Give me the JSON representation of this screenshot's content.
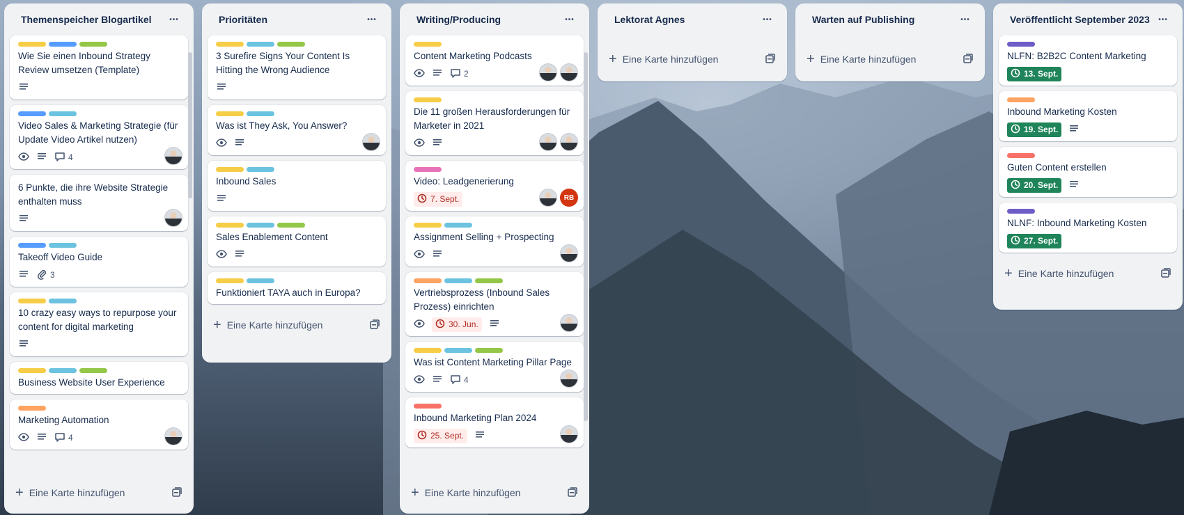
{
  "colors": {
    "yellow": "#f5cd47",
    "blue": "#579dff",
    "green": "#94c748",
    "sky": "#6cc3e0",
    "orange": "#fea362",
    "pink": "#e774bb",
    "red": "#f87168",
    "purple": "#6e5dc6",
    "done_green": "#1f845a",
    "overdue_bg": "#ffeceb"
  },
  "add_card_label": "Eine Karte hinzufügen",
  "lists": [
    {
      "title": "Themenspeicher Blogartikel",
      "cards": [
        {
          "labels": [
            "yellow",
            "blue",
            "green"
          ],
          "title": "Wie Sie einen Inbound Strategy Review umsetzen (Template)",
          "badges": {
            "desc": true
          }
        },
        {
          "labels": [
            "blue",
            "sky"
          ],
          "title": "Video Sales & Marketing Strategie (für Update Video Artikel nutzen)",
          "badges": {
            "watch": true,
            "desc": true,
            "comments": "4"
          },
          "members": [
            "avatar"
          ]
        },
        {
          "labels": [],
          "title": "6 Punkte, die ihre Website Strategie enthalten muss",
          "badges": {
            "desc": true
          },
          "members": [
            "avatar"
          ]
        },
        {
          "labels": [
            "blue",
            "sky"
          ],
          "title": "Takeoff Video Guide",
          "badges": {
            "desc": true,
            "attachments": "3"
          }
        },
        {
          "labels": [
            "yellow",
            "sky"
          ],
          "title": "10 crazy easy ways to repurpose your content for digital marketing",
          "badges": {
            "desc": true
          }
        },
        {
          "labels": [
            "yellow",
            "sky",
            "green"
          ],
          "title": "Business Website User Experience",
          "badges": {}
        },
        {
          "labels": [
            "orange"
          ],
          "title": "Marketing Automation",
          "badges": {
            "watch": true,
            "desc": true,
            "comments": "4"
          },
          "members": [
            "avatar"
          ]
        }
      ]
    },
    {
      "title": "Prioritäten",
      "cards": [
        {
          "labels": [
            "yellow",
            "sky",
            "green"
          ],
          "title": "3 Surefire Signs Your Content Is Hitting the Wrong Audience",
          "badges": {
            "desc": true
          }
        },
        {
          "labels": [
            "yellow",
            "sky"
          ],
          "title": "Was ist They Ask, You Answer?",
          "badges": {
            "watch": true,
            "desc": true
          },
          "members": [
            "avatar"
          ]
        },
        {
          "labels": [
            "yellow",
            "sky"
          ],
          "title": "Inbound Sales",
          "badges": {
            "desc": true
          }
        },
        {
          "labels": [
            "yellow",
            "sky",
            "green"
          ],
          "title": "Sales Enablement Content",
          "badges": {
            "watch": true,
            "desc": true
          }
        },
        {
          "labels": [
            "yellow",
            "sky"
          ],
          "title": "Funktioniert TAYA auch in Europa?",
          "badges": {}
        }
      ]
    },
    {
      "title": "Writing/Producing",
      "cards": [
        {
          "labels": [
            "yellow"
          ],
          "title": "Content Marketing Podcasts",
          "badges": {
            "watch": true,
            "desc": true,
            "comments": "2"
          },
          "members": [
            "avatar",
            "avatar"
          ]
        },
        {
          "labels": [
            "yellow"
          ],
          "title": "Die 11 großen Herausforderungen für Marketer in 2021",
          "badges": {
            "watch": true,
            "desc": true
          },
          "members": [
            "avatar",
            "avatar"
          ]
        },
        {
          "labels": [
            "pink"
          ],
          "title": "Video: Leadgenerierung",
          "badges": {
            "due": "7. Sept.",
            "due_state": "overdue"
          },
          "members": [
            "avatar",
            "RB"
          ]
        },
        {
          "labels": [
            "yellow",
            "sky"
          ],
          "title": "Assignment Selling + Prospecting",
          "badges": {
            "watch": true,
            "desc": true
          },
          "members": [
            "avatar"
          ]
        },
        {
          "labels": [
            "orange",
            "sky",
            "green"
          ],
          "title": "Vertriebsprozess (Inbound Sales Prozess) einrichten",
          "badges": {
            "watch": true,
            "due": "30. Jun.",
            "due_state": "overdue",
            "desc": true
          },
          "members": [
            "avatar"
          ]
        },
        {
          "labels": [
            "yellow",
            "sky",
            "green"
          ],
          "title": "Was ist Content Marketing Pillar Page",
          "badges": {
            "watch": true,
            "desc": true,
            "comments": "4"
          },
          "members": [
            "avatar"
          ]
        },
        {
          "labels": [
            "red"
          ],
          "title": "Inbound Marketing Plan 2024",
          "badges": {
            "due": "25. Sept.",
            "due_state": "overdue",
            "desc": true
          },
          "members": [
            "avatar"
          ]
        }
      ]
    },
    {
      "title": "Lektorat Agnes",
      "cards": []
    },
    {
      "title": "Warten auf Publishing",
      "cards": []
    },
    {
      "title": "Veröffentlicht September 2023",
      "cards": [
        {
          "labels": [
            "purple"
          ],
          "title": "NLFN: B2B2C Content Marketing",
          "badges": {
            "due": "13. Sept.",
            "due_state": "done"
          }
        },
        {
          "labels": [
            "orange"
          ],
          "title": "Inbound Marketing Kosten",
          "badges": {
            "due": "19. Sept.",
            "due_state": "done",
            "desc": true
          }
        },
        {
          "labels": [
            "red"
          ],
          "title": "Guten Content erstellen",
          "badges": {
            "due": "20. Sept.",
            "due_state": "done",
            "desc": true
          }
        },
        {
          "labels": [
            "purple"
          ],
          "title": "NLNF: Inbound Marketing Kosten",
          "badges": {
            "due": "27. Sept.",
            "due_state": "done"
          }
        }
      ]
    }
  ]
}
